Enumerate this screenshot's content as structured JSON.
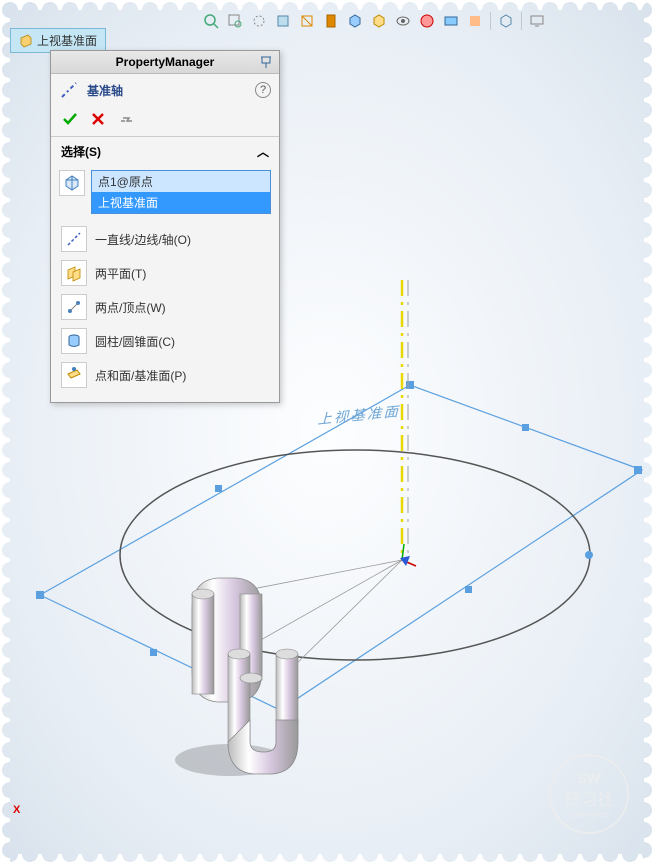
{
  "toolbar": {
    "tools": [
      "zoom-fit",
      "zoom-area",
      "zoom-dynamic",
      "rotate",
      "pan",
      "section",
      "display-style",
      "cube-1",
      "cube-2",
      "hide-show",
      "appearance",
      "scene",
      "render",
      "sep",
      "view-orient",
      "sep",
      "monitor"
    ]
  },
  "plane_tab": {
    "label": "上视基准面"
  },
  "property_manager": {
    "title": "PropertyManager",
    "feature_name": "基准轴",
    "actions": {
      "ok": "✓",
      "cancel": "✕",
      "pin": "📌"
    },
    "section_label": "选择(S)",
    "selections": [
      {
        "text": "点1@原点",
        "type": "soft"
      },
      {
        "text": "上视基准面",
        "type": "selected"
      }
    ],
    "options": [
      {
        "id": "line-edge-axis",
        "label": "一直线/边线/轴(O)"
      },
      {
        "id": "two-planes",
        "label": "两平面(T)"
      },
      {
        "id": "two-points",
        "label": "两点/顶点(W)"
      },
      {
        "id": "cylindrical",
        "label": "圆柱/圆锥面(C)"
      },
      {
        "id": "point-face",
        "label": "点和面/基准面(P)"
      }
    ]
  },
  "viewport": {
    "plane_label_3d": "上视基准面"
  },
  "watermark": {
    "sw": "SW",
    "cn": "研习社",
    "sub": "SolidWorks"
  },
  "red_marker": "X"
}
